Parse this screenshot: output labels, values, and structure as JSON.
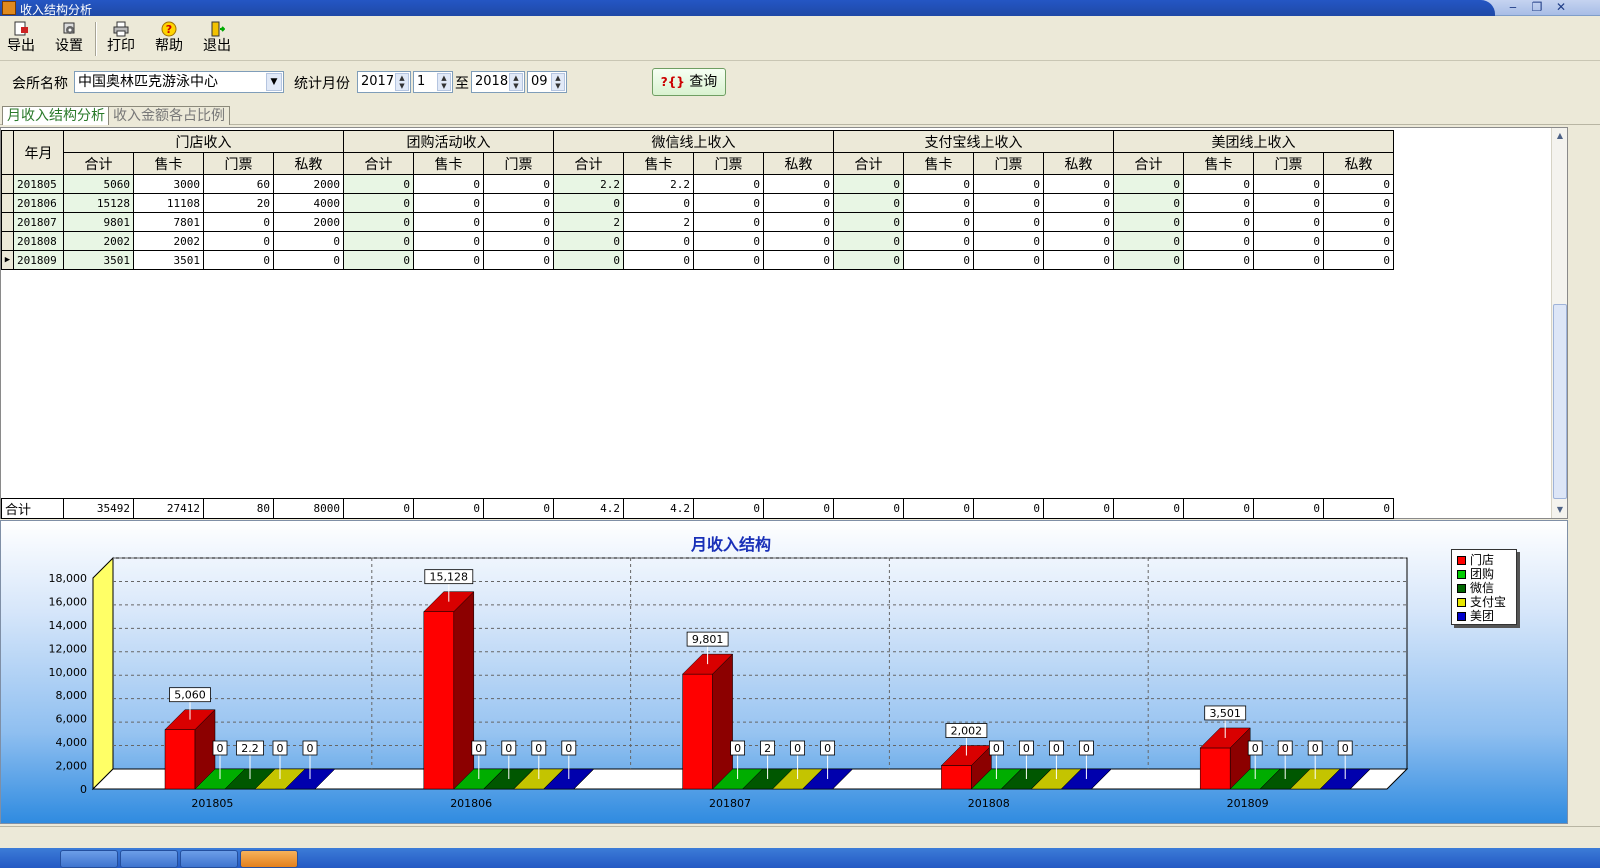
{
  "window": {
    "title": "收入结构分析",
    "minimize": "‒",
    "restore": "❐",
    "close": "✕"
  },
  "toolbar": {
    "export": "导出",
    "settings": "设置",
    "print": "打印",
    "help": "帮助",
    "exit": "退出"
  },
  "filter": {
    "club_label": "会所名称",
    "club_value": "中国奥林匹克游泳中心",
    "month_label": "统计月份",
    "from_year": "2017",
    "from_month": "1",
    "to_label": "至",
    "to_year": "2018",
    "to_month": "09",
    "query_icon": "?{}",
    "query_label": "查询"
  },
  "tabs": {
    "tab1": "月收入结构分析",
    "tab2": "收入金额各占比例"
  },
  "grid": {
    "ym_header": "年月",
    "groups": [
      "门店收入",
      "团购活动收入",
      "微信线上收入",
      "支付宝线上收入",
      "美团线上收入"
    ],
    "subheaders": [
      "合计",
      "售卡",
      "门票",
      "私教",
      "合计",
      "售卡",
      "门票",
      "合计",
      "售卡",
      "门票",
      "私教",
      "合计",
      "售卡",
      "门票",
      "私教",
      "合计",
      "售卡",
      "门票",
      "私教"
    ],
    "rows": [
      [
        "201805",
        "5060",
        "3000",
        "60",
        "2000",
        "0",
        "0",
        "0",
        "2.2",
        "2.2",
        "0",
        "0",
        "0",
        "0",
        "0",
        "0",
        "0",
        "0",
        "0",
        "0"
      ],
      [
        "201806",
        "15128",
        "11108",
        "20",
        "4000",
        "0",
        "0",
        "0",
        "0",
        "0",
        "0",
        "0",
        "0",
        "0",
        "0",
        "0",
        "0",
        "0",
        "0",
        "0"
      ],
      [
        "201807",
        "9801",
        "7801",
        "0",
        "2000",
        "0",
        "0",
        "0",
        "2",
        "2",
        "0",
        "0",
        "0",
        "0",
        "0",
        "0",
        "0",
        "0",
        "0",
        "0"
      ],
      [
        "201808",
        "2002",
        "2002",
        "0",
        "0",
        "0",
        "0",
        "0",
        "0",
        "0",
        "0",
        "0",
        "0",
        "0",
        "0",
        "0",
        "0",
        "0",
        "0",
        "0"
      ],
      [
        "201809",
        "3501",
        "3501",
        "0",
        "0",
        "0",
        "0",
        "0",
        "0",
        "0",
        "0",
        "0",
        "0",
        "0",
        "0",
        "0",
        "0",
        "0",
        "0",
        "0"
      ]
    ],
    "totals": [
      "合计",
      "35492",
      "27412",
      "80",
      "8000",
      "0",
      "0",
      "0",
      "4.2",
      "4.2",
      "0",
      "0",
      "0",
      "0",
      "0",
      "0",
      "0",
      "0",
      "0",
      "0"
    ]
  },
  "chart_data": {
    "type": "bar",
    "title": "月收入结构",
    "categories": [
      "201805",
      "201806",
      "201807",
      "201808",
      "201809"
    ],
    "series": [
      {
        "name": "门店",
        "color": "#ff0000",
        "values": [
          5060,
          15128,
          9801,
          2002,
          3501
        ],
        "labels": [
          "5,060",
          "15,128",
          "9,801",
          "2,002",
          "3,501"
        ]
      },
      {
        "name": "团购",
        "color": "#00cc00",
        "values": [
          0,
          0,
          0,
          0,
          0
        ],
        "labels": [
          "0",
          "0",
          "0",
          "0",
          "0"
        ]
      },
      {
        "name": "微信",
        "color": "#006600",
        "values": [
          2.2,
          0,
          2,
          0,
          0
        ],
        "labels": [
          "2.2",
          "0",
          "2",
          "0",
          "0"
        ]
      },
      {
        "name": "支付宝",
        "color": "#e6e600",
        "values": [
          0,
          0,
          0,
          0,
          0
        ],
        "labels": [
          "0",
          "0",
          "0",
          "0",
          "0"
        ]
      },
      {
        "name": "美团",
        "color": "#0000cc",
        "values": [
          0,
          0,
          0,
          0,
          0
        ],
        "labels": [
          "0",
          "0",
          "0",
          "0",
          "0"
        ]
      }
    ],
    "ylim": [
      0,
      18000
    ],
    "yticks": [
      "0",
      "2,000",
      "4,000",
      "6,000",
      "8,000",
      "10,000",
      "12,000",
      "14,000",
      "16,000",
      "18,000"
    ],
    "grid": true,
    "legend_position": "top-right"
  }
}
